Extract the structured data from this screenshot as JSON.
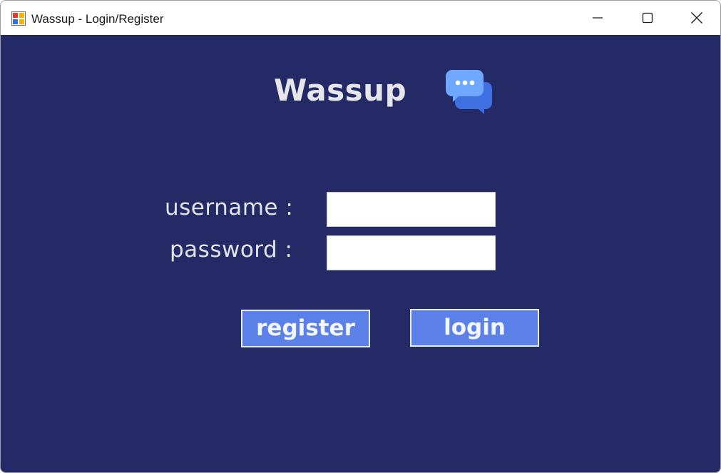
{
  "window": {
    "title": "Wassup - Login/Register",
    "controls": [
      "minimize",
      "maximize",
      "close"
    ]
  },
  "app": {
    "brand_name": "Wassup",
    "brand_icon": "chat-bubbles-icon"
  },
  "form": {
    "username_label": "username :",
    "username_value": "",
    "password_label": "password :",
    "password_value": ""
  },
  "buttons": {
    "register_label": "register",
    "login_label": "login"
  },
  "colors": {
    "background": "#232a66",
    "button_fill": "#5b80e8",
    "text": "#e6e6ea",
    "icon_light": "#6ea8ff",
    "icon_dark": "#3f6fe0"
  }
}
